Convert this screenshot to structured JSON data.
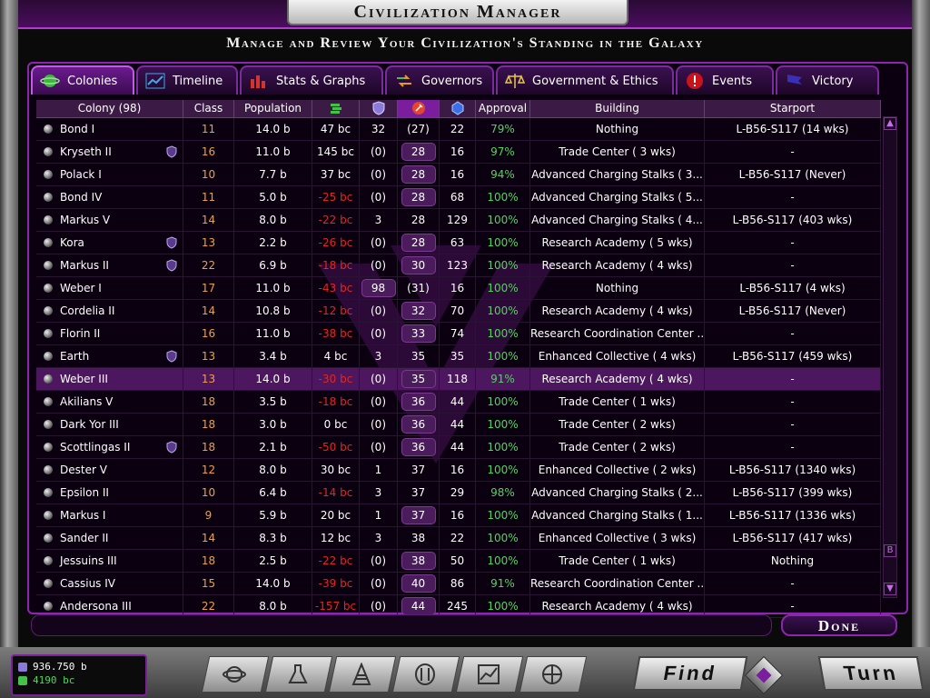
{
  "window": {
    "title": "Civilization Manager",
    "subtitle": "Manage and Review Your Civilization's Standing in the Galaxy"
  },
  "tabs": [
    {
      "label": "Colonies",
      "icon": "planet-icon",
      "active": true
    },
    {
      "label": "Timeline",
      "icon": "line-chart-icon",
      "active": false
    },
    {
      "label": "Stats & Graphs",
      "icon": "bar-chart-icon",
      "active": false
    },
    {
      "label": "Governors",
      "icon": "arrows-icon",
      "active": false
    },
    {
      "label": "Government & Ethics",
      "icon": "scales-icon",
      "active": false
    },
    {
      "label": "Events",
      "icon": "alert-icon",
      "active": false
    },
    {
      "label": "Victory",
      "icon": "flag-icon",
      "active": false
    }
  ],
  "table": {
    "headers": {
      "colony": "Colony (98)",
      "class": "Class",
      "population": "Population",
      "cash_icon": "money-icon",
      "defense_icon": "shield-icon",
      "industry_icon": "hammer-icon",
      "research_icon": "research-icon",
      "approval": "Approval",
      "building": "Building",
      "starport": "Starport"
    },
    "rows": [
      {
        "name": "Bond I",
        "shield": false,
        "class": "11",
        "pop": "14.0 b",
        "cash": "47 bc",
        "cash_neg": false,
        "def": "32",
        "def_pill": false,
        "ind": "(27)",
        "ind_pill": false,
        "res": "22",
        "approval": "79%",
        "building": "Nothing",
        "starport": "L-B56-S117 (14 wks)",
        "selected": false
      },
      {
        "name": "Kryseth II",
        "shield": true,
        "class": "16",
        "pop": "11.0 b",
        "cash": "145 bc",
        "cash_neg": false,
        "def": "(0)",
        "def_pill": false,
        "ind": "28",
        "ind_pill": true,
        "res": "16",
        "approval": "97%",
        "building": "Trade Center ( 3 wks)",
        "starport": "-",
        "selected": false
      },
      {
        "name": "Polack I",
        "shield": false,
        "class": "10",
        "pop": "7.7 b",
        "cash": "37 bc",
        "cash_neg": false,
        "def": "(0)",
        "def_pill": false,
        "ind": "28",
        "ind_pill": true,
        "res": "16",
        "approval": "94%",
        "building": "Advanced Charging Stalks ( 3...",
        "starport": "L-B56-S117 (Never)",
        "selected": false
      },
      {
        "name": "Bond IV",
        "shield": false,
        "class": "11",
        "pop": "5.0 b",
        "cash": "-25 bc",
        "cash_neg": true,
        "def": "(0)",
        "def_pill": false,
        "ind": "28",
        "ind_pill": true,
        "res": "68",
        "approval": "100%",
        "building": "Advanced Charging Stalks ( 5...",
        "starport": "-",
        "selected": false
      },
      {
        "name": "Markus V",
        "shield": false,
        "class": "14",
        "pop": "8.0 b",
        "cash": "-22 bc",
        "cash_neg": true,
        "def": "3",
        "def_pill": false,
        "ind": "28",
        "ind_pill": false,
        "res": "129",
        "approval": "100%",
        "building": "Advanced Charging Stalks ( 4...",
        "starport": "L-B56-S117 (403 wks)",
        "selected": false
      },
      {
        "name": "Kora",
        "shield": true,
        "class": "13",
        "pop": "2.2 b",
        "cash": "-26 bc",
        "cash_neg": true,
        "def": "(0)",
        "def_pill": false,
        "ind": "28",
        "ind_pill": true,
        "res": "63",
        "approval": "100%",
        "building": "Research Academy ( 5 wks)",
        "starport": "-",
        "selected": false
      },
      {
        "name": "Markus II",
        "shield": true,
        "class": "22",
        "pop": "6.9 b",
        "cash": "-18 bc",
        "cash_neg": true,
        "def": "(0)",
        "def_pill": false,
        "ind": "30",
        "ind_pill": true,
        "res": "123",
        "approval": "100%",
        "building": "Research Academy ( 4 wks)",
        "starport": "-",
        "selected": false
      },
      {
        "name": "Weber I",
        "shield": false,
        "class": "17",
        "pop": "11.0 b",
        "cash": "-43 bc",
        "cash_neg": true,
        "def": "98",
        "def_pill": true,
        "ind": "(31)",
        "ind_pill": false,
        "res": "16",
        "approval": "100%",
        "building": "Nothing",
        "starport": "L-B56-S117 (4 wks)",
        "selected": false
      },
      {
        "name": "Cordelia II",
        "shield": false,
        "class": "14",
        "pop": "10.8 b",
        "cash": "-12 bc",
        "cash_neg": true,
        "def": "(0)",
        "def_pill": false,
        "ind": "32",
        "ind_pill": true,
        "res": "70",
        "approval": "100%",
        "building": "Research Academy ( 4 wks)",
        "starport": "L-B56-S117 (Never)",
        "selected": false
      },
      {
        "name": "Florin II",
        "shield": false,
        "class": "16",
        "pop": "11.0 b",
        "cash": "-38 bc",
        "cash_neg": true,
        "def": "(0)",
        "def_pill": false,
        "ind": "33",
        "ind_pill": true,
        "res": "74",
        "approval": "100%",
        "building": "Research Coordination Center ...",
        "starport": "-",
        "selected": false
      },
      {
        "name": "Earth",
        "shield": true,
        "class": "13",
        "pop": "3.4 b",
        "cash": "4 bc",
        "cash_neg": false,
        "def": "3",
        "def_pill": false,
        "ind": "35",
        "ind_pill": false,
        "res": "35",
        "approval": "100%",
        "building": "Enhanced Collective ( 4 wks)",
        "starport": "L-B56-S117 (459 wks)",
        "selected": false
      },
      {
        "name": "Weber III",
        "shield": false,
        "class": "13",
        "pop": "14.0 b",
        "cash": "-30 bc",
        "cash_neg": true,
        "def": "(0)",
        "def_pill": false,
        "ind": "35",
        "ind_pill": true,
        "res": "118",
        "approval": "91%",
        "building": "Research Academy ( 4 wks)",
        "starport": "-",
        "selected": true
      },
      {
        "name": "Akilians V",
        "shield": false,
        "class": "18",
        "pop": "3.5 b",
        "cash": "-18 bc",
        "cash_neg": true,
        "def": "(0)",
        "def_pill": false,
        "ind": "36",
        "ind_pill": true,
        "res": "44",
        "approval": "100%",
        "building": "Trade Center ( 1 wks)",
        "starport": "-",
        "selected": false
      },
      {
        "name": "Dark Yor III",
        "shield": false,
        "class": "18",
        "pop": "3.0 b",
        "cash": "0 bc",
        "cash_neg": false,
        "def": "(0)",
        "def_pill": false,
        "ind": "36",
        "ind_pill": true,
        "res": "44",
        "approval": "100%",
        "building": "Trade Center ( 2 wks)",
        "starport": "-",
        "selected": false
      },
      {
        "name": "Scottlingas II",
        "shield": true,
        "class": "18",
        "pop": "2.1 b",
        "cash": "-50 bc",
        "cash_neg": true,
        "def": "(0)",
        "def_pill": false,
        "ind": "36",
        "ind_pill": true,
        "res": "44",
        "approval": "100%",
        "building": "Trade Center ( 2 wks)",
        "starport": "-",
        "selected": false
      },
      {
        "name": "Dester V",
        "shield": false,
        "class": "12",
        "pop": "8.0 b",
        "cash": "30 bc",
        "cash_neg": false,
        "def": "1",
        "def_pill": false,
        "ind": "37",
        "ind_pill": false,
        "res": "16",
        "approval": "100%",
        "building": "Enhanced Collective ( 2 wks)",
        "starport": "L-B56-S117 (1340 wks)",
        "selected": false
      },
      {
        "name": "Epsilon II",
        "shield": false,
        "class": "10",
        "pop": "6.4 b",
        "cash": "-14 bc",
        "cash_neg": true,
        "def": "3",
        "def_pill": false,
        "ind": "37",
        "ind_pill": false,
        "res": "29",
        "approval": "98%",
        "building": "Advanced Charging Stalks ( 2...",
        "starport": "L-B56-S117 (399 wks)",
        "selected": false
      },
      {
        "name": "Markus I",
        "shield": false,
        "class": "9",
        "pop": "5.9 b",
        "cash": "20 bc",
        "cash_neg": false,
        "def": "1",
        "def_pill": false,
        "ind": "37",
        "ind_pill": true,
        "res": "16",
        "approval": "100%",
        "building": "Advanced Charging Stalks ( 1...",
        "starport": "L-B56-S117 (1336 wks)",
        "selected": false
      },
      {
        "name": "Sander II",
        "shield": false,
        "class": "14",
        "pop": "8.3 b",
        "cash": "12 bc",
        "cash_neg": false,
        "def": "3",
        "def_pill": false,
        "ind": "38",
        "ind_pill": false,
        "res": "22",
        "approval": "100%",
        "building": "Enhanced Collective ( 3 wks)",
        "starport": "L-B56-S117 (417 wks)",
        "selected": false
      },
      {
        "name": "Jessuins III",
        "shield": false,
        "class": "18",
        "pop": "2.5 b",
        "cash": "-22 bc",
        "cash_neg": true,
        "def": "(0)",
        "def_pill": false,
        "ind": "38",
        "ind_pill": true,
        "res": "50",
        "approval": "100%",
        "building": "Trade Center ( 1 wks)",
        "starport": "Nothing",
        "selected": false
      },
      {
        "name": "Cassius IV",
        "shield": false,
        "class": "15",
        "pop": "14.0 b",
        "cash": "-39 bc",
        "cash_neg": true,
        "def": "(0)",
        "def_pill": false,
        "ind": "40",
        "ind_pill": true,
        "res": "86",
        "approval": "91%",
        "building": "Research Coordination Center ...",
        "starport": "-",
        "selected": false
      },
      {
        "name": "Andersona III",
        "shield": false,
        "class": "22",
        "pop": "8.0 b",
        "cash": "-157 bc",
        "cash_neg": true,
        "def": "(0)",
        "def_pill": false,
        "ind": "44",
        "ind_pill": true,
        "res": "245",
        "approval": "100%",
        "building": "Research Academy ( 4 wks)",
        "starport": "-",
        "selected": false
      }
    ]
  },
  "done_label": "Done",
  "treasury": {
    "population": "936.750 b",
    "cash": "4190 bc"
  },
  "nav_buttons": [
    "planets-icon",
    "research-flask-icon",
    "ships-icon",
    "races-icon",
    "chart-icon",
    "tech-icon"
  ],
  "find_label": "Find",
  "turn_label": "Turn",
  "colors": {
    "accent": "#8e25b1",
    "positive": "#4fd65a",
    "negative": "#e0281e",
    "class": "#f0a03c"
  }
}
